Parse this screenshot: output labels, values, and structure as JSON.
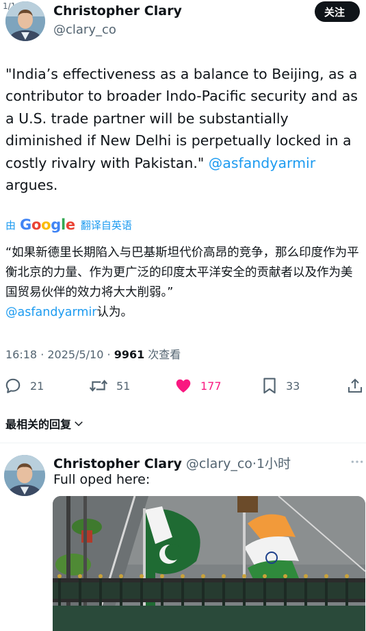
{
  "page_counter": "1/1",
  "author": {
    "name": "Christopher Clary",
    "handle": "@clary_co"
  },
  "follow_label": "关注",
  "tweet": {
    "text_before": "\"India’s effectiveness as a balance to Beijing, as a contributor to broader Indo-Pacific security and as a U.S. trade partner will be substantially diminished if New Delhi is perpetually locked in a costly rivalry with Pakistan.\" ",
    "mention": "@asfandyarmir",
    "text_after": " argues."
  },
  "translation": {
    "by_label": "由",
    "google_label": "Google",
    "action_label": "翻译自英语",
    "text_before": "“如果新德里长期陷入与巴基斯坦代价高昂的竞争，那么印度作为平衡北京的力量、作为更广泛的印度太平洋安全的贡献者以及作为美国贸易伙伴的效力将大大削弱。”",
    "mention": "@asfandyarmir",
    "text_after": "认为。"
  },
  "meta": {
    "time": "16:18",
    "sep1": " · ",
    "date": "2025/5/10",
    "sep2": " · ",
    "views": "9961",
    "views_label": " 次查看"
  },
  "actions": {
    "replies": "21",
    "retweets": "51",
    "likes": "177",
    "bookmarks": "33"
  },
  "colors": {
    "accent": "#1d9bf0",
    "like": "#f91880",
    "text": "#0f1419",
    "secondary": "#536471"
  },
  "replies_section_label": "最相关的回复",
  "reply": {
    "name": "Christopher Clary",
    "handle": "@clary_co",
    "sep": "·",
    "time": "1小时",
    "text": "Full oped here:"
  }
}
